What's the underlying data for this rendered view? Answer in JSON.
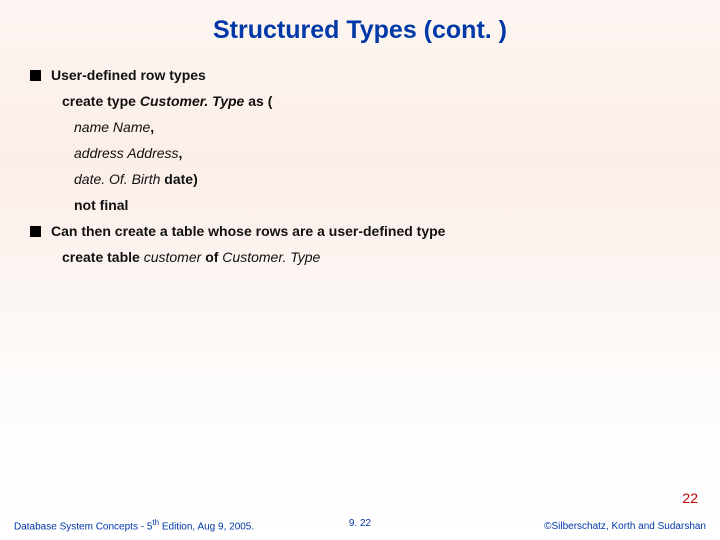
{
  "title": "Structured Types (cont. )",
  "bullets": {
    "b1": "User-defined row types",
    "b2": "Can then create a table whose rows are a user-defined type"
  },
  "code": {
    "create_kw1": "create type ",
    "type_name": "Customer. Type ",
    "as_paren": "as (",
    "field1_name": "name ",
    "field1_type": "Name",
    "comma1": ",",
    "field2_name": "address ",
    "field2_type": "Address",
    "comma2": ",",
    "field3_name": "date. Of. Birth ",
    "field3_type": "date",
    "close_paren": ")",
    "not_final": "not final",
    "create_table_kw": "create table ",
    "table_name": "customer ",
    "of_kw": "of ",
    "of_type": "Customer. Type"
  },
  "page_number": "22",
  "footer": {
    "left_a": "Database System Concepts - 5",
    "left_sup": "th",
    "left_b": " Edition, Aug 9, 2005.",
    "center": "9. 22",
    "right": "©Silberschatz, Korth and Sudarshan"
  }
}
